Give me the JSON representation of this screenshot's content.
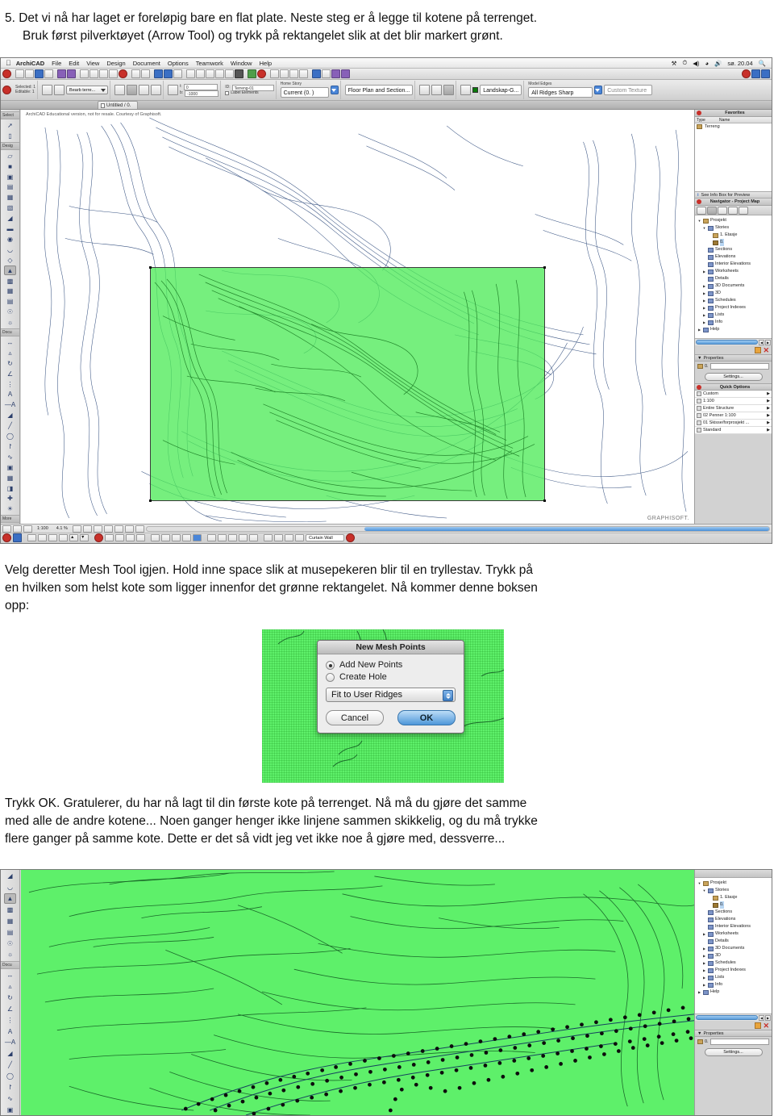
{
  "intro": {
    "line1": "5. Det vi nå har laget er foreløpig bare en flat plate. Neste steg er å legge til kotene på terrenget.",
    "line2": "Bruk først pilverktøyet (Arrow Tool) og trykk på rektangelet slik at det blir markert grønt."
  },
  "mid_text": {
    "line1": "Velg deretter Mesh Tool igjen. Hold inne space slik at musepekeren blir til en tryllestav. Trykk på",
    "line2": "en hvilken som helst kote som ligger innenfor det grønne rektangelet. Nå kommer denne boksen",
    "line3": "opp:"
  },
  "bottom_text": {
    "line1": "Trykk OK. Gratulerer, du har nå lagt til din første kote på terrenget. Nå må du gjøre det samme",
    "line2": "med alle de andre kotene... Noen ganger henger ikke linjene sammen skikkelig, og du må trykke",
    "line3": "flere ganger på samme kote. Dette er det så vidt jeg vet ikke noe å gjøre med, dessverre..."
  },
  "app": {
    "menubar": {
      "apple": "",
      "items": [
        "ArchiCAD",
        "File",
        "Edit",
        "View",
        "Design",
        "Document",
        "Options",
        "Teamwork",
        "Window",
        "Help"
      ],
      "status_time": "sø. 20.04"
    },
    "tab": {
      "label": "Untitled / 0."
    },
    "watermark": "ArchiCAD Educational version, not for resale. Courtesy of Graphisoft.",
    "logo": "GRAPHISOFT.",
    "infobox": {
      "selected_label": "Selected: 1",
      "editable_label": "Editable: 1",
      "layer_value": "Bearb terre...",
      "coord_x_label": "t:",
      "coord_x_value": "0",
      "coord_y_label": "b:",
      "coord_y_value": "-1000",
      "id_label": "ID:",
      "id_value": "Terreng-01",
      "label_elements": "Label Elements",
      "home_story_label": "Home Story",
      "home_story_value": "Current (0. )",
      "view_value": "Floor Plan and Section...",
      "material_value": "Landskap-G...",
      "model_edges_label": "Model Edges",
      "model_edges_value": "All Ridges Sharp",
      "custom_texture": "Custom Texture"
    },
    "toolbox": {
      "groups": [
        {
          "name": "Select",
          "label": "Select"
        },
        {
          "name": "Design",
          "label": "Desig"
        },
        {
          "name": "Document",
          "label": "Docu"
        },
        {
          "name": "More",
          "label": "More"
        }
      ]
    },
    "favorites": {
      "title": "Favorites",
      "col_type": "Type",
      "col_name": "Name",
      "row_name": "Terreng"
    },
    "info_hint": "See Info Box for Preview",
    "navigator": {
      "title": "Navigator - Project Map",
      "tree": [
        {
          "label": "Prosjekt",
          "depth": 0,
          "arrow": "▼",
          "kind": "folder"
        },
        {
          "label": "Stories",
          "depth": 1,
          "arrow": "▼",
          "kind": "item"
        },
        {
          "label": "1. Etasje",
          "depth": 2,
          "arrow": "",
          "kind": "folder"
        },
        {
          "label": "0.",
          "depth": 2,
          "arrow": "",
          "kind": "folderdark",
          "selected": true
        },
        {
          "label": "Sections",
          "depth": 1,
          "arrow": "",
          "kind": "item"
        },
        {
          "label": "Elevations",
          "depth": 1,
          "arrow": "",
          "kind": "item"
        },
        {
          "label": "Interior Elevations",
          "depth": 1,
          "arrow": "",
          "kind": "item"
        },
        {
          "label": "Worksheets",
          "depth": 1,
          "arrow": "▶",
          "kind": "item"
        },
        {
          "label": "Details",
          "depth": 1,
          "arrow": "",
          "kind": "item"
        },
        {
          "label": "3D Documents",
          "depth": 1,
          "arrow": "▶",
          "kind": "item"
        },
        {
          "label": "3D",
          "depth": 1,
          "arrow": "▶",
          "kind": "item"
        },
        {
          "label": "Schedules",
          "depth": 1,
          "arrow": "▶",
          "kind": "item"
        },
        {
          "label": "Project Indexes",
          "depth": 1,
          "arrow": "▶",
          "kind": "item"
        },
        {
          "label": "Lists",
          "depth": 1,
          "arrow": "▶",
          "kind": "item"
        },
        {
          "label": "Info",
          "depth": 1,
          "arrow": "▶",
          "kind": "item"
        },
        {
          "label": "Help",
          "depth": 0,
          "arrow": "▶",
          "kind": "item"
        }
      ]
    },
    "properties": {
      "title": "Properties",
      "story_value": "0.",
      "settings_button": "Settings..."
    },
    "quick_options": {
      "title": "Quick Options",
      "rows": [
        "Custom",
        "1:100",
        "Entire Structure",
        "02 Penner 1:100",
        "01 Skisse/forprosjekt ...",
        "Standard"
      ]
    },
    "statusbar": {
      "scale": "1:100",
      "zoom": "4.1 %",
      "tool": "Curtain Wall"
    }
  },
  "dialog": {
    "title": "New Mesh Points",
    "options": [
      {
        "label": "Add New Points",
        "selected": true
      },
      {
        "label": "Create Hole",
        "selected": false
      }
    ],
    "fit_value": "Fit to User Ridges",
    "cancel_label": "Cancel",
    "ok_label": "OK"
  },
  "colors": {
    "selection_green": "#50eb5a",
    "mesh_green": "#5ef06a",
    "contour_blue": "#2f4b7c",
    "accent_blue": "#4a90d9"
  }
}
